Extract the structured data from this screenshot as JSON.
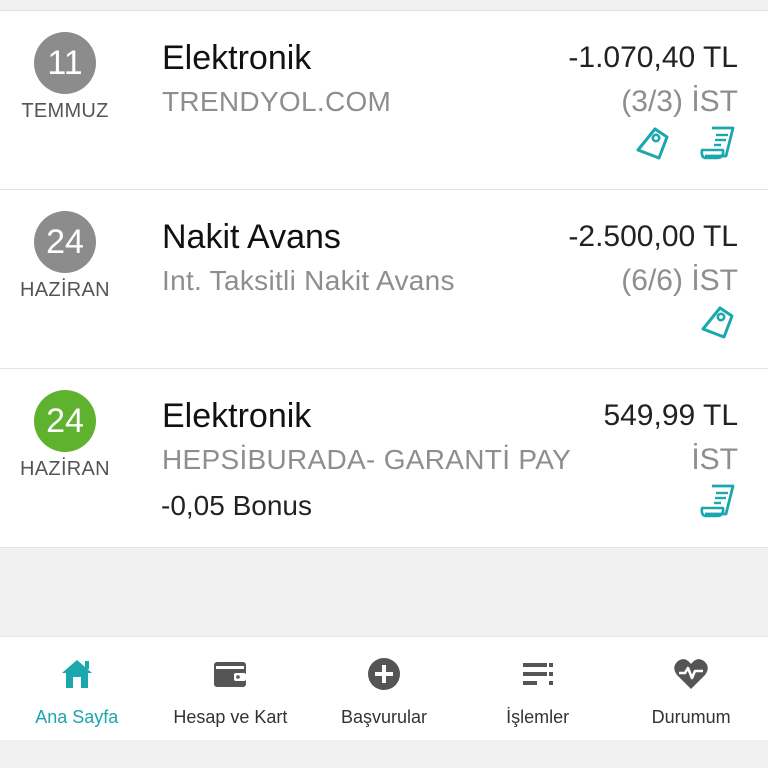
{
  "transactions": [
    {
      "day": "11",
      "month": "TEMMUZ",
      "title": "Elektronik",
      "merchant": "TRENDYOL.COM",
      "amount": "-1.070,40 TL",
      "installment": "(3/3) İST",
      "bonus": "",
      "day_circle_color": "#8c8c8c",
      "icons": [
        "tag-icon",
        "receipt-icon"
      ]
    },
    {
      "day": "24",
      "month": "HAZİRAN",
      "title": "Nakit Avans",
      "merchant": "Int. Taksitli Nakit Avans",
      "amount": "-2.500,00 TL",
      "installment": "(6/6) İST",
      "bonus": "",
      "day_circle_color": "#8c8c8c",
      "icons": [
        "tag-icon"
      ]
    },
    {
      "day": "24",
      "month": "HAZİRAN",
      "title": "Elektronik",
      "merchant": "HEPSİBURADA- GARANTİ PAY",
      "amount": "549,99 TL",
      "installment": "İST",
      "bonus": "-0,05 Bonus",
      "day_circle_color": "#5eb22e",
      "icons": [
        "receipt-icon"
      ]
    }
  ],
  "nav": {
    "items": [
      {
        "label": "Ana Sayfa",
        "icon": "home-icon",
        "active": true
      },
      {
        "label": "Hesap ve Kart",
        "icon": "wallet-icon",
        "active": false
      },
      {
        "label": "Başvurular",
        "icon": "plus-circle-icon",
        "active": false
      },
      {
        "label": "İşlemler",
        "icon": "list-icon",
        "active": false
      },
      {
        "label": "Durumum",
        "icon": "heart-pulse-icon",
        "active": false
      }
    ]
  },
  "colors": {
    "accent": "#1aa7ae",
    "active_nav": "#1aa7ae",
    "inactive_icon": "#555555"
  }
}
